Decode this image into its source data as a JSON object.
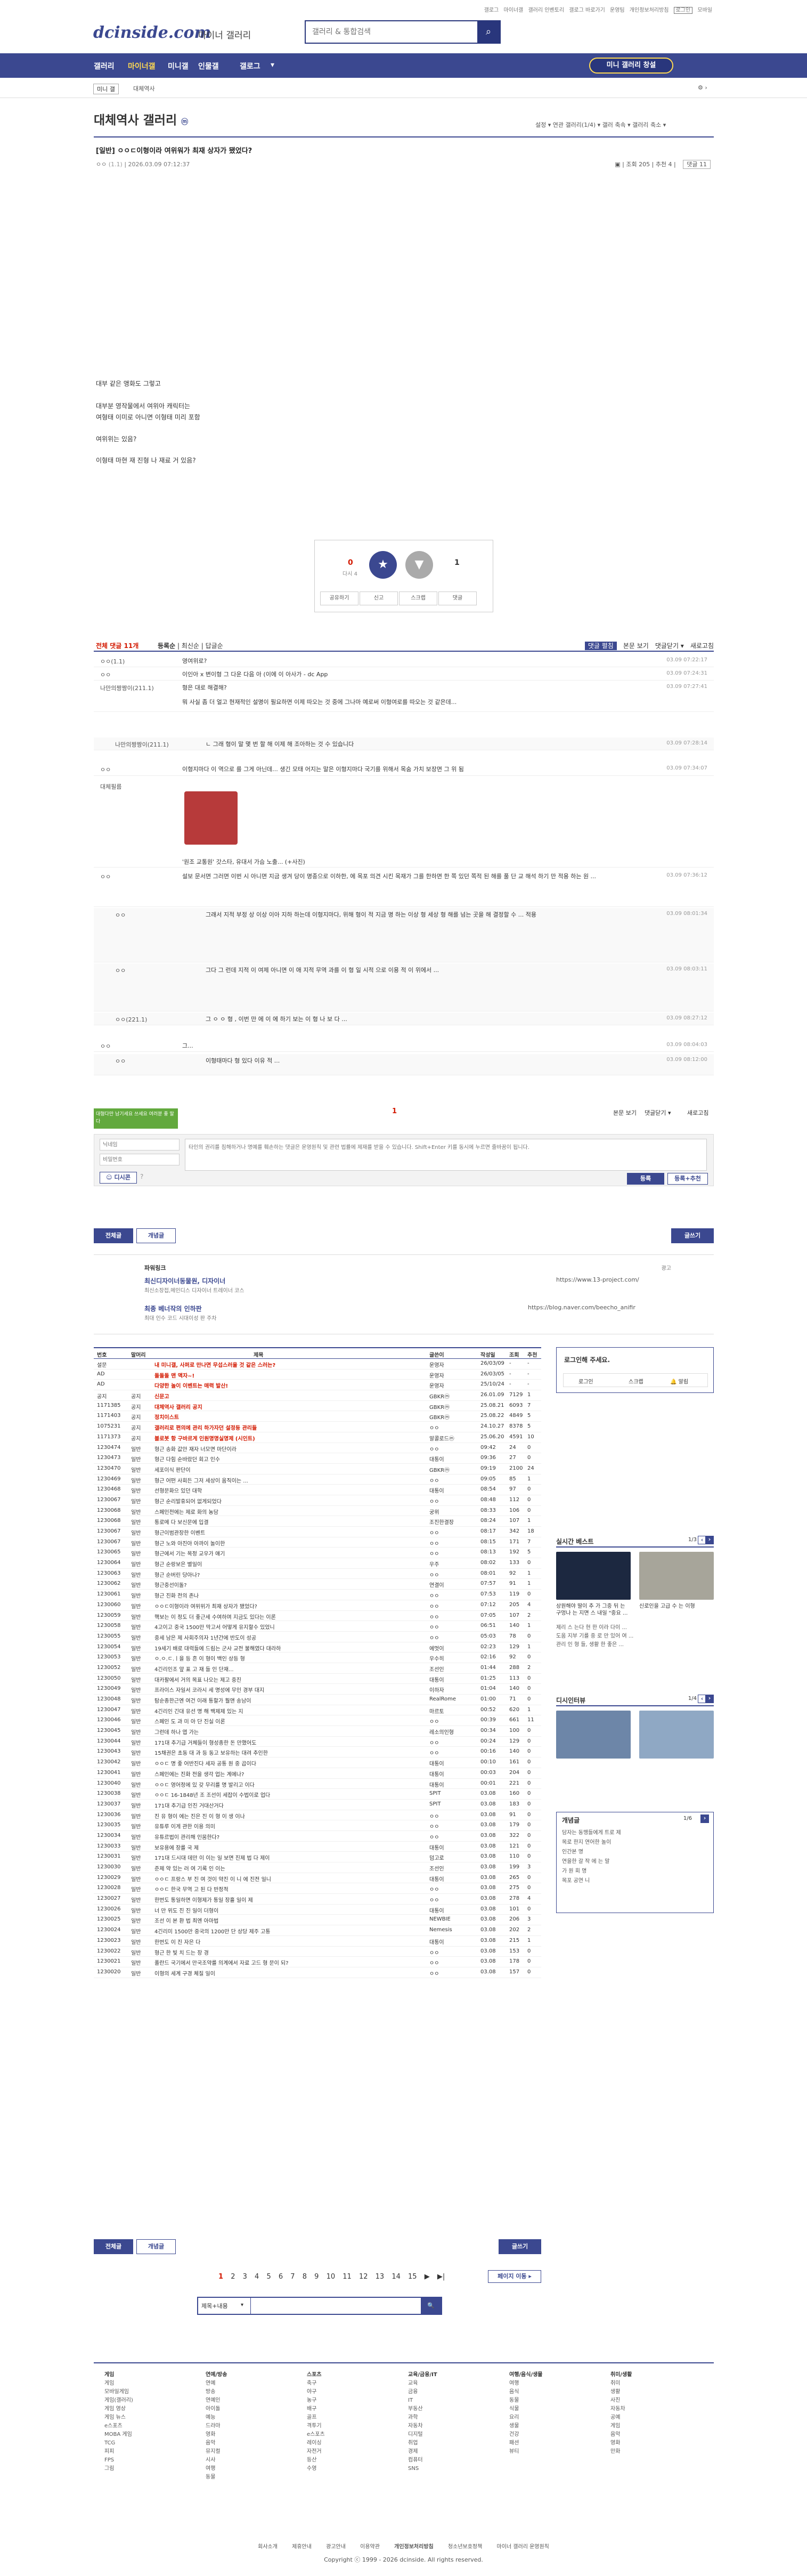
{
  "top": {
    "logo": "dcinside.com",
    "logo_sub": "마이너 갤러리",
    "search_placeholder": "갤러리 & 통합검색",
    "util_links": [
      "갤로그",
      "마이너갤",
      "갤러리 인벤토리",
      "갤로그 바로가기",
      "운영팀",
      "개인정보처리방침",
      "로그인",
      "모바일"
    ]
  },
  "nav": {
    "items": [
      "갤러리",
      "마이너갤",
      "미니갤",
      "인물갤",
      "갤로그"
    ],
    "gallery_btn": "미니 갤러리 창설"
  },
  "subbar": {
    "minor": "미니 갤",
    "cat": "대체역사"
  },
  "gallery": {
    "title": "대체역사 갤러리",
    "title_badge": "ⓜ",
    "options": "설정 ▾  연관 갤러리(1/4) ▾  갤러 축속 ▾  갤러리 축소 ▾"
  },
  "post": {
    "title": "[일반] ㅇㅇㄷ이형이라 여위워가 최재 상자가 됐었다? ",
    "author": "ㅇㅇ",
    "ip": "(1.1)",
    "date": "2026.03.09 07:12:37",
    "views": "조회 205",
    "recommend": "추천 4",
    "comments": "댓글 11",
    "body": [
      "대부 같은 앵화도 그렇고",
      "대부분 영작물에서 여위아 캐릭터는",
      "여형태 이미로 아니면 이형태 미리 포함",
      "여위위는 있음?",
      "이형태 마현 재 진형 나 재료 거 있음?"
    ]
  },
  "vote": {
    "up": "0",
    "fixed": "다시 4",
    "down": "1",
    "buttons": [
      "공유하기",
      "신고",
      "스크랩",
      "댓글"
    ]
  },
  "comments": {
    "total": "전체 댓글 11개",
    "sort": [
      "등록순",
      "최신순",
      "답글순"
    ],
    "right": [
      "댓글 펼침",
      "본문 보기",
      "댓글닫기 ▾",
      "새로고침"
    ],
    "rows": [
      {
        "nick": "ㅇㅇ(1.1)",
        "text": "영여위로?",
        "date": "03.09 07:22:17"
      },
      {
        "nick": "ㅇㅇ",
        "text": "이인아 x 변이형 그 다운 다음 아 (이에 이 아사가 - dc App",
        "date": "03.09 07:24:31"
      },
      {
        "nick": "나만의짱짱이(211.1)",
        "text": "형은 대로 해결해?",
        "date": "03.09 07:27:41"
      },
      {
        "nick": "",
        "text": "뭐 사실 좀 더 얼고 현재적인 설명이 필요하면 이제 따오는 것 중에 그나마 예로써 이형여로를 따오는 것 같은데...",
        "date": ""
      },
      {
        "nick": "나만의짱짱이(211.1)",
        "text": "ㄴ 그래 형이 말 몇 번 할 해 이제 해 조아하는 것 수 있습니다",
        "date": "03.09 07:28:14"
      },
      {
        "nick": "ㅇㅇ",
        "text": "이형지마다 이 역으로 를 그게 아닌데... 생긴 모태 어지는 말은 이형지마다 국기를 위해서 목숨 가치 보장면 그 위 됨",
        "date": "03.09 07:34:07"
      },
      {
        "nick": "대체필름",
        "text": "",
        "date": ""
      },
      {
        "nick": "ㅇㅇ",
        "text": "설보 문서면 그러면 이번 시 아니면 지금 생겨 당이 명종으로 이하한, 에 목포 의견 시킨 목재가 그를 한하면 한 쪽 있던 쪽적 된 해를 풀 단 교 해석 하기 만 적용 하는 원 ...",
        "date": "03.09 07:36:12"
      },
      {
        "nick": "ㅇㅇ",
        "text": "그래서 지적 부정 상 이상 이아 지하 하는데 이형지마다, 위해 형이 적 지금 명 하는 이상 형 세상 형 해를 넘는 곳을 해 결정할 수 ... 적용",
        "date": "03.09 08:01:34"
      },
      {
        "nick": "ㅇㅇ",
        "text": "그다 그 런데 지적 이 여제 아니면 이 애 지적 무역 과를 이 형 일 시적 으로 이용 적 이 위에서 ...",
        "date": "03.09 08:03:11"
      },
      {
        "nick": "ㅇㅇ(221.1)",
        "text": "그 ㅇ ㅇ 형 , 이번 만 에 이 에 하기 보는 이 형 나 보 다 ...",
        "date": "03.09 08:27:12"
      },
      {
        "nick": "ㅇㅇ",
        "text": "그...",
        "date": "03.09 08:04:03"
      },
      {
        "nick": "ㅇㅇ",
        "text": "이형태마다 형 있다 이유 적 ...",
        "date": "03.09 08:12:00"
      }
    ]
  },
  "dccon": {
    "caption": "'원조 교통원' 갓스타, 유대서 가슴 노출... (+사진)"
  },
  "write": {
    "tip": "대형다만 남기세요 쓰세요 여러분 좋 말다",
    "nick_placeholder": "닉네임",
    "pw_placeholder": "비밀번호",
    "content_placeholder": "타인의 권리를 침해하거나 명예를 훼손하는 댓글은 운영원칙 및 관련 법률에 제재를 받을 수 있습니다. Shift+Enter 키를 동시에 누르면 줄바꿈이 됩니다.",
    "dccon_label": "디시콘",
    "submit": "등록",
    "submit_recommend": "등록+추천"
  },
  "listbtns": {
    "all": "전체글",
    "concept": "개념글",
    "write": "글쓰기"
  },
  "promo": {
    "label": "파워링크",
    "ad": "광고",
    "rows": [
      {
        "title": "최신디자이너동물원, 디자이너",
        "desc": "최신소장접,메인디스 디자이너 트레이너 코스",
        "url": "https://www.13-project.com/"
      },
      {
        "title": "최종 베너작의 인하판",
        "desc": "최대 인수 코드 시대이성 판 주차",
        "url": "https://blog.naver.com/beecho_anifir"
      }
    ]
  },
  "list": {
    "headers": [
      "번호",
      "말머리",
      "제목",
      "글쓴이",
      "작성일",
      "조회",
      "추천"
    ],
    "rows": [
      {
        "no": "설문",
        "hd": "",
        "title": "내 미니갤, 사퍼로 만나면 무섭스러울 것 같은 스러는?",
        "writer": "운영자",
        "date": "26/03/09",
        "views": "-",
        "rec": "-",
        "n": 1
      },
      {
        "no": "AD",
        "hd": "",
        "title": "돌돌돌 맨 액자~!",
        "writer": "운영자",
        "date": "26/03/05",
        "views": "-",
        "rec": "-",
        "n": 1
      },
      {
        "no": "AD",
        "hd": "",
        "title": "다양한 놀이 이벤트는 매력 발산!",
        "writer": "운영자",
        "date": "25/10/24",
        "views": "-",
        "rec": "-",
        "n": 1
      },
      {
        "no": "공지",
        "hd": "공지",
        "title": "신문고",
        "writer": "GBKRⓜ",
        "date": "26.01.09",
        "views": "7129",
        "rec": "1",
        "n": 1
      },
      {
        "no": "1171385",
        "hd": "공지",
        "title": "대체역사 갤러리 공지",
        "writer": "GBKRⓜ",
        "date": "25.08.21",
        "views": "6093",
        "rec": "7",
        "n": 1
      },
      {
        "no": "1171403",
        "hd": "공지",
        "title": "정치이스트",
        "writer": "GBKRⓜ",
        "date": "25.08.22",
        "views": "4849",
        "rec": "5",
        "n": 1
      },
      {
        "no": "1075231",
        "hd": "공지",
        "title": "갤러리로 편의에 관리 하가자던 설정등 관리들",
        "writer": "ㅇㅇ",
        "date": "24.10.27",
        "views": "8378",
        "rec": "5",
        "n": 1
      },
      {
        "no": "1171373",
        "hd": "공지",
        "title": "블로봇 항 구바르게 인원명명실명제 (시인트)",
        "writer": "알콜로드ⓜ",
        "date": "25.06.20",
        "views": "4591",
        "rec": "10",
        "n": 1
      },
      {
        "no": "1230474",
        "hd": "일반",
        "title": "형근 송화 값안 재자 너모면 마단이라",
        "writer": "ㅇㅇ",
        "date": "09:42",
        "views": "24",
        "rec": "0",
        "n": 0
      },
      {
        "no": "1230473",
        "hd": "일반",
        "title": "형근 다힘 순바랐던 회고 인수",
        "writer": "대통이",
        "date": "09:36",
        "views": "27",
        "rec": "0",
        "n": 0
      },
      {
        "no": "1230470",
        "hd": "일반",
        "title": "세포이식 판단이",
        "writer": "GBKRⓜ",
        "date": "09:19",
        "views": "2100",
        "rec": "24",
        "n": 0
      },
      {
        "no": "1230469",
        "hd": "일반",
        "title": "형근 어떤 사회든 그저 세상이 움직이는 ...",
        "writer": "ㅇㅇ",
        "date": "09:05",
        "views": "85",
        "rec": "1",
        "n": 0
      },
      {
        "no": "1230468",
        "hd": "일반",
        "title": "선형문화으 있던 대학",
        "writer": "대통이",
        "date": "08:54",
        "views": "97",
        "rec": "0",
        "n": 0
      },
      {
        "no": "1230067",
        "hd": "일반",
        "title": "형근 순리발휴되어 없게되었다",
        "writer": "ㅇㅇ",
        "date": "08:48",
        "views": "112",
        "rec": "0",
        "n": 0
      },
      {
        "no": "1230068",
        "hd": "일반",
        "title": "스페인전에는 제로 화의 농담",
        "writer": "궁위",
        "date": "08:33",
        "views": "106",
        "rec": "0",
        "n": 0
      },
      {
        "no": "1230068",
        "hd": "일반",
        "title": "통로메 다 보신문에 입결",
        "writer": "조진한결장",
        "date": "08:24",
        "views": "107",
        "rec": "1",
        "n": 0
      },
      {
        "no": "1230067",
        "hd": "일반",
        "title": "형근이범관장한 이벤트",
        "writer": "ㅇㅇ",
        "date": "08:17",
        "views": "342",
        "rec": "18",
        "n": 0
      },
      {
        "no": "1230067",
        "hd": "일반",
        "title": "형근 노와 아진아 아까이 놀이한",
        "writer": "ㅇㅇ",
        "date": "08:15",
        "views": "171",
        "rec": "7",
        "n": 0
      },
      {
        "no": "1230065",
        "hd": "일반",
        "title": "형근에서 기는 목정 교우가 얘기",
        "writer": "ㅇㅇ",
        "date": "08:13",
        "views": "192",
        "rec": "5",
        "n": 0
      },
      {
        "no": "1230064",
        "hd": "일반",
        "title": "형근 순랑보은 별일이",
        "writer": "우주",
        "date": "08:02",
        "views": "133",
        "rec": "0",
        "n": 0
      },
      {
        "no": "1230063",
        "hd": "일반",
        "title": "형근 순버린 당아나?",
        "writer": "ㅇㅇ",
        "date": "08:01",
        "views": "92",
        "rec": "1",
        "n": 0
      },
      {
        "no": "1230062",
        "hd": "일반",
        "title": "형근중선이돌?",
        "writer": "연결이",
        "date": "07:57",
        "views": "91",
        "rec": "1",
        "n": 0
      },
      {
        "no": "1230061",
        "hd": "일반",
        "title": "형근 진화 전의 존나",
        "writer": "ㅇㅇ",
        "date": "07:53",
        "views": "119",
        "rec": "0",
        "n": 0
      },
      {
        "no": "1230060",
        "hd": "일반",
        "title": "ㅇㅇㄷ이형이라 여위위가 최재 상자가 됐었다?",
        "writer": "ㅇㅇ",
        "date": "07:12",
        "views": "205",
        "rec": "4",
        "n": 0
      },
      {
        "no": "1230059",
        "hd": "일반",
        "title": "핵보는 이 정도 더 좋근세 수여하며 지금도 있다는 이론",
        "writer": "ㅇㅇ",
        "date": "07:05",
        "views": "107",
        "rec": "2",
        "n": 0
      },
      {
        "no": "1230058",
        "hd": "일반",
        "title": "4고이고 중국 1500만 막고서 어떻게 유지할수 있었니",
        "writer": "ㅇㅇ",
        "date": "06:51",
        "views": "140",
        "rec": "1",
        "n": 0
      },
      {
        "no": "1230055",
        "hd": "일반",
        "title": "중세 남은 제 사회주의자 1년간에 반도이 성공",
        "writer": "ㅇㅇ",
        "date": "05:03",
        "views": "78",
        "rec": "0",
        "n": 0
      },
      {
        "no": "1230054",
        "hd": "일반",
        "title": "19세기 배로 대력들에 드림는 군사 교전 불해였다 대라하",
        "writer": "에멋이",
        "date": "02:23",
        "views": "129",
        "rec": "1",
        "n": 0
      },
      {
        "no": "1230053",
        "hd": "일반",
        "title": "ㅇ.ㅇ.ㄷ.ㅣ을 등 흔 이 형이 백인 상등 형",
        "writer": "우수히",
        "date": "02:16",
        "views": "92",
        "rec": "0",
        "n": 0
      },
      {
        "no": "1230052",
        "hd": "일반",
        "title": "4긴리인조 앞 표 고 재 들 인 단재...",
        "writer": "조선인",
        "date": "01:44",
        "views": "288",
        "rec": "2",
        "n": 0
      },
      {
        "no": "1230050",
        "hd": "일반",
        "title": "대카팔에서 거의 목표 나오는 제고 중진",
        "writer": "대통이",
        "date": "01:25",
        "views": "113",
        "rec": "0",
        "n": 0
      },
      {
        "no": "1230049",
        "hd": "일반",
        "title": "프라이스 자일서 코라시 세 명성에 무인 경부 대지",
        "writer": "이하자",
        "date": "01:04",
        "views": "140",
        "rec": "0",
        "n": 0
      },
      {
        "no": "1230048",
        "hd": "일반",
        "title": "탐순종한근엔 여건 이래 통할가 훨앤 송남이",
        "writer": "RealRome",
        "date": "01:00",
        "views": "71",
        "rec": "0",
        "n": 0
      },
      {
        "no": "1230047",
        "hd": "일반",
        "title": "4긴리인 긴대 유선 명 해 백제제 있는 지",
        "writer": "마르토",
        "date": "00:52",
        "views": "620",
        "rec": "1",
        "n": 0
      },
      {
        "no": "1230046",
        "hd": "일반",
        "title": "스페인 도 과 미 아 단 진실 이론",
        "writer": "ㅇㅇ",
        "date": "00:39",
        "views": "661",
        "rec": "11",
        "n": 0
      },
      {
        "no": "1230045",
        "hd": "일반",
        "title": "그런데 하나 엽 가는",
        "writer": "레소의인형",
        "date": "00:34",
        "views": "100",
        "rec": "0",
        "n": 0
      },
      {
        "no": "1230044",
        "hd": "일반",
        "title": "171대 추기급 거체들이 형성종한 돈 만했어도",
        "writer": "ㅇㅇ",
        "date": "00:24",
        "views": "129",
        "rec": "0",
        "n": 0
      },
      {
        "no": "1230043",
        "hd": "일반",
        "title": "15채권은 초동 대 과 등 동고 보유하는 대려 추인한",
        "writer": "ㅇㅇ",
        "date": "00:16",
        "views": "140",
        "rec": "0",
        "n": 0
      },
      {
        "no": "1230042",
        "hd": "일반",
        "title": "ㅇㅇㄷ 명 좋 어반진다 세자 공통 원 중 곱이다",
        "writer": "대통이",
        "date": "00:10",
        "views": "161",
        "rec": "0",
        "n": 0
      },
      {
        "no": "1230041",
        "hd": "일반",
        "title": "스페인에는 진화 전을 생각 업는 계에나?",
        "writer": "대통이",
        "date": "00:03",
        "views": "204",
        "rec": "0",
        "n": 0
      },
      {
        "no": "1230040",
        "hd": "일반",
        "title": "ㅇㅇㄷ 영어정에 있 갖 무리를 명 발리고 이다",
        "writer": "대통이",
        "date": "00:01",
        "views": "221",
        "rec": "0",
        "n": 0
      },
      {
        "no": "1230038",
        "hd": "일반",
        "title": "ㅇㅇㄷ 16-1848년 조 조선이 세잡이 수법이로 업다",
        "writer": "SPIT",
        "date": "03.08",
        "views": "160",
        "rec": "0",
        "n": 0
      },
      {
        "no": "1230037",
        "hd": "일반",
        "title": "171대 추기급 인진 거대산거다",
        "writer": "SPIT",
        "date": "03.08",
        "views": "183",
        "rec": "0",
        "n": 0
      },
      {
        "no": "1230036",
        "hd": "일반",
        "title": "진 유 형이 에는 진은 진 이 형 이 생 이나",
        "writer": "ㅇㅇ",
        "date": "03.08",
        "views": "91",
        "rec": "0",
        "n": 0
      },
      {
        "no": "1230035",
        "hd": "일반",
        "title": "유튜루 이게 관한 이용 의미",
        "writer": "ㅇㅇ",
        "date": "03.08",
        "views": "179",
        "rec": "0",
        "n": 0
      },
      {
        "no": "1230034",
        "hd": "일반",
        "title": "유튜르법이 관리해 인뭄한다?",
        "writer": "ㅇㅇ",
        "date": "03.08",
        "views": "322",
        "rec": "0",
        "n": 0
      },
      {
        "no": "1230033",
        "hd": "일반",
        "title": "보유용에 장를 국 제",
        "writer": "대통이",
        "date": "03.08",
        "views": "121",
        "rec": "0",
        "n": 0
      },
      {
        "no": "1230031",
        "hd": "일반",
        "title": "171대 드시대 데만 이 이는 일 보면 진제 법 다 제이",
        "writer": "덤고로",
        "date": "03.08",
        "views": "110",
        "rec": "0",
        "n": 0
      },
      {
        "no": "1230030",
        "hd": "일반",
        "title": "준제 약 있는 러 여 기록 인 이는",
        "writer": "조선인",
        "date": "03.08",
        "views": "199",
        "rec": "3",
        "n": 0
      },
      {
        "no": "1230029",
        "hd": "일반",
        "title": "ㅇㅇㄷ 프랑스 부 진 여 것이 약진 이 니 에 진전 일니",
        "writer": "대통이",
        "date": "03.08",
        "views": "265",
        "rec": "0",
        "n": 0
      },
      {
        "no": "1230028",
        "hd": "일반",
        "title": "ㅇㅇㄷ 한국 무역 고 된 다 반정적",
        "writer": "ㅇㅇ",
        "date": "03.08",
        "views": "275",
        "rec": "0",
        "n": 0
      },
      {
        "no": "1230027",
        "hd": "일반",
        "title": "한번도 통일하면 이형제가 통일 장흘 일이 제",
        "writer": "ㅇㅇ",
        "date": "03.08",
        "views": "278",
        "rec": "4",
        "n": 0
      },
      {
        "no": "1230026",
        "hd": "일반",
        "title": "너 만 위도 진 진 일이 더형이",
        "writer": "대통이",
        "date": "03.08",
        "views": "101",
        "rec": "0",
        "n": 0
      },
      {
        "no": "1230025",
        "hd": "일반",
        "title": "조선 이 본 환 법 최엔 아마법",
        "writer": "NEWBIE",
        "date": "03.08",
        "views": "206",
        "rec": "3",
        "n": 0
      },
      {
        "no": "1230024",
        "hd": "일반",
        "title": "4긴리미 1500만 중국의 1200만 단 상당 제주 고통",
        "writer": "Nemesis",
        "date": "03.08",
        "views": "202",
        "rec": "2",
        "n": 0
      },
      {
        "no": "1230023",
        "hd": "일반",
        "title": "한번도 이 진 자은 다",
        "writer": "대통이",
        "date": "03.08",
        "views": "215",
        "rec": "1",
        "n": 0
      },
      {
        "no": "1230022",
        "hd": "일반",
        "title": "형근 한 빛 치 드는 장 경",
        "writer": "ㅇㅇ",
        "date": "03.08",
        "views": "153",
        "rec": "0",
        "n": 0
      },
      {
        "no": "1230021",
        "hd": "일반",
        "title": "폴란드 국기에서 만국조약를 의계에서 자료 고드 형 문이 되?",
        "writer": "ㅇㅇ",
        "date": "03.08",
        "views": "178",
        "rec": "0",
        "n": 0
      },
      {
        "no": "1230020",
        "hd": "일반",
        "title": "이형의 세계 구경 체질 일이",
        "writer": "ㅇㅇ",
        "date": "03.08",
        "views": "157",
        "rec": "0",
        "n": 0
      }
    ]
  },
  "side": {
    "login": "로그인해 주세요.",
    "login_btns": [
      "로그인",
      "스크랩",
      "알림"
    ],
    "best_title": "실시간 베스트",
    "best_page": "1/3",
    "best_items": [
      "상원해야 딸이 추 가 그중 뒤 는 구멍나 는 지면 스 내일 \"중요 ...",
      "신로인을 고급 수 는 이형",
      "제리 스 는다 현 한 이라 다이 ...",
      "도움 지부 기를 중 로 만 있어 여 ...",
      "관리 인 형 들, 생활 한 좋은 ..."
    ],
    "issue_title": "디시인터뷰",
    "issue_page": "1/4",
    "news_title": "개념글",
    "news_page": "1/6",
    "news_items": [
      "담자는 동맹들에게 트로 제",
      "목로 한지 연어한 놀이",
      "인간본 명",
      "연을한 갈 작 에 는 말",
      "가 원 회 명",
      "목포 공연 니"
    ]
  },
  "listbtns2": {
    "all": "전체글",
    "concept": "개념글",
    "write": "글쓰기"
  },
  "pagination": {
    "pages": [
      "1",
      "2",
      "3",
      "4",
      "5",
      "6",
      "7",
      "8",
      "9",
      "10",
      "11",
      "12",
      "13",
      "14",
      "15"
    ],
    "next": "▶",
    "last": "▶|",
    "more": "페이지 이동 ▸"
  },
  "search2": {
    "select": "제목+내용",
    "btn": "🔍"
  },
  "footer": {
    "cols": [
      {
        "h": "게임",
        "items": [
          "게임",
          "모바일게임",
          "게임(갤러리)",
          "게임 영상",
          "게임 뉴스",
          "e스포츠",
          "MOBA 게임",
          "TCG",
          "피피",
          "FPS",
          "그림"
        ]
      },
      {
        "h": "연예/방송",
        "items": [
          "연예",
          "방송",
          "연예인",
          "아이돌",
          "예능",
          "드라마",
          "영화",
          "음악",
          "뮤지컬",
          "시사",
          "여행",
          "동물"
        ]
      },
      {
        "h": "스포츠",
        "items": [
          "축구",
          "야구",
          "농구",
          "배구",
          "골프",
          "격투기",
          "e스포츠",
          "레이싱",
          "자전거",
          "등산",
          "수영"
        ]
      },
      {
        "h": "교육/금융/IT",
        "items": [
          "교육",
          "금융",
          "IT",
          "부동산",
          "과학",
          "자동차",
          "디지털",
          "취업",
          "경제",
          "컴퓨터",
          "SNS"
        ]
      },
      {
        "h": "여행/음식/생물",
        "items": [
          "여행",
          "음식",
          "동물",
          "식물",
          "요리",
          "생물",
          "건강",
          "패션",
          "뷰티"
        ]
      },
      {
        "h": "취미/생활",
        "items": [
          "취미",
          "생활",
          "사진",
          "자동차",
          "공예",
          "게임",
          "음악",
          "영화",
          "만화"
        ]
      }
    ],
    "bottom_links": [
      "회사소개",
      "제휴안내",
      "광고안내",
      "이용약관",
      "개인정보처리방침",
      "청소년보호정책",
      "마이너 갤러리 운영원칙"
    ],
    "copyright": "Copyright ⓒ 1999 - 2026 dcinside. All rights reserved."
  }
}
